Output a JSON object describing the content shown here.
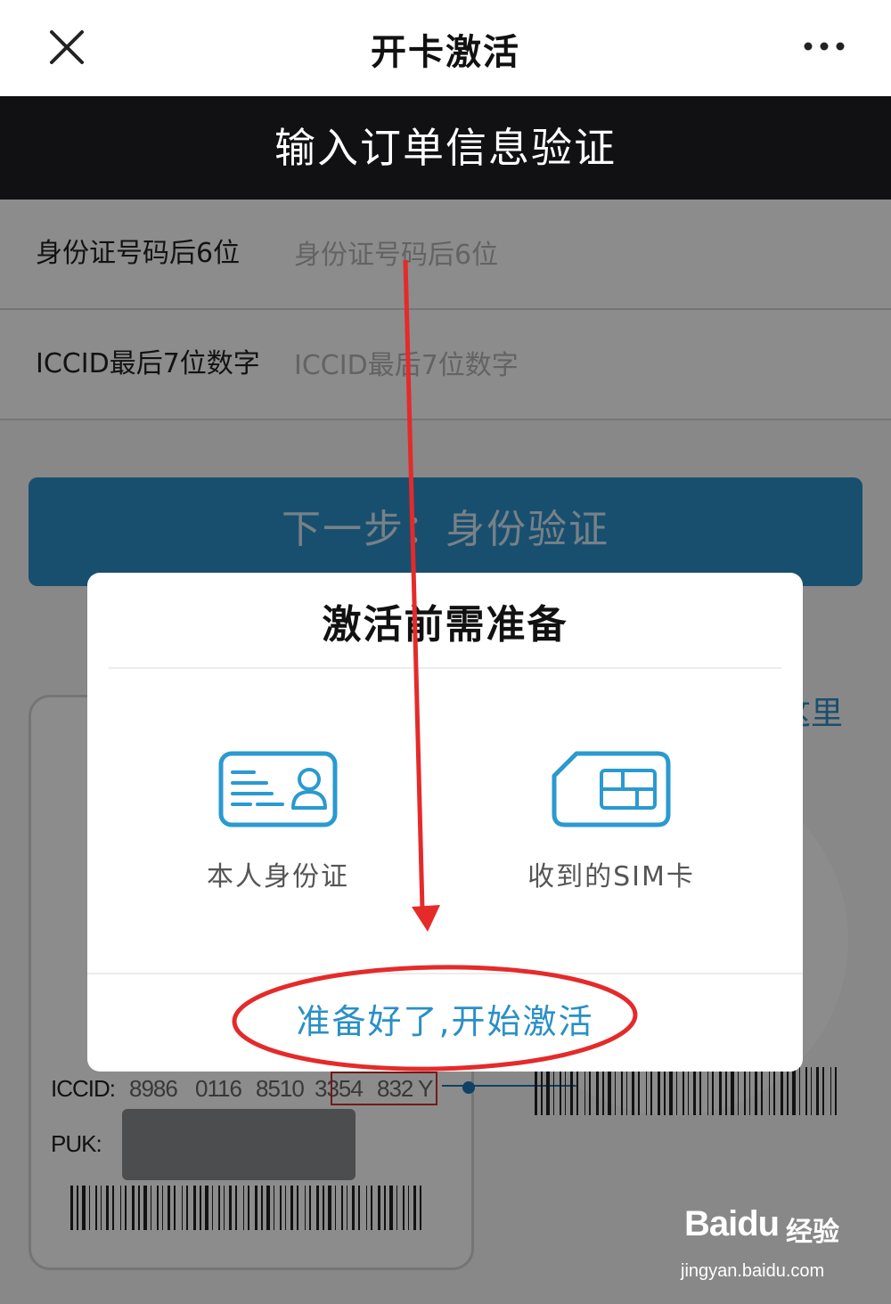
{
  "header": {
    "title": "开卡激活",
    "close_icon": "close-icon",
    "more_icon": "more-dots-icon"
  },
  "banner": {
    "text": "输入订单信息验证"
  },
  "form": {
    "id_label": "身份证号码后6位",
    "id_placeholder": "身份证号码后6位",
    "iccid_label": "ICCID最后7位数字",
    "iccid_placeholder": "ICCID最后7位数字"
  },
  "next_button": {
    "label": "下一步：身份验证"
  },
  "help_link": {
    "text": "这里"
  },
  "sim_card_example": {
    "iccid_label": "ICCID:",
    "iccid_segments": [
      "8986",
      "0116",
      "8510",
      "3354",
      "832",
      "Y"
    ],
    "puk_label": "PUK:"
  },
  "dialog": {
    "title": "激活前需准备",
    "items": [
      {
        "label": "本人身份证",
        "icon": "id-card-icon"
      },
      {
        "label": "收到的SIM卡",
        "icon": "sim-card-icon"
      }
    ],
    "start_button": "准备好了,开始激活"
  },
  "watermark": {
    "brand": "Baidu",
    "cn": "经验",
    "url": "jingyan.baidu.com"
  },
  "colors": {
    "accent": "#2a8fc6",
    "banner_bg": "#111113",
    "annotation_red": "#e52a2a"
  }
}
